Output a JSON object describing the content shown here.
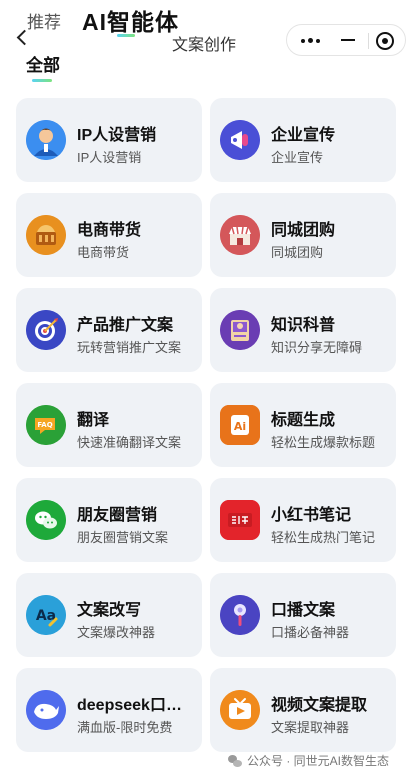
{
  "top_tabs": {
    "recommend": "推荐",
    "ai_agents": "AI智能体"
  },
  "nav": {
    "title": "文案创作"
  },
  "category": {
    "all": "全部"
  },
  "cards": [
    {
      "title": "IP人设营销",
      "sub": "IP人设营销",
      "icon": "avatar-person-icon",
      "color": "#2f7de1"
    },
    {
      "title": "企业宣传",
      "sub": "企业宣传",
      "icon": "megaphone-icon",
      "color": "#4b4fd8"
    },
    {
      "title": "电商带货",
      "sub": "电商带货",
      "icon": "shop-basket-icon",
      "color": "#e58a1f"
    },
    {
      "title": "同城团购",
      "sub": "同城团购",
      "icon": "storefront-icon",
      "color": "#d35a5a"
    },
    {
      "title": "产品推广文案",
      "sub": "玩转营销推广文案",
      "icon": "target-icon",
      "color": "#3b4bc8"
    },
    {
      "title": "知识科普",
      "sub": "知识分享无障碍",
      "icon": "book-icon",
      "color": "#6a3fb5"
    },
    {
      "title": "翻译",
      "sub": "快速准确翻译文案",
      "icon": "faq-icon",
      "color": "#2ea33a"
    },
    {
      "title": "标题生成",
      "sub": "轻松生成爆款标题",
      "icon": "ai-badge-icon",
      "color": "#e8731a"
    },
    {
      "title": "朋友圈营销",
      "sub": "朋友圈营销文案",
      "icon": "wechat-icon",
      "color": "#1faa3a"
    },
    {
      "title": "小红书笔记",
      "sub": "轻松生成热门笔记",
      "icon": "xiaohongshu-icon",
      "color": "#e3242b"
    },
    {
      "title": "文案改写",
      "sub": "文案爆改神器",
      "icon": "text-aa-icon",
      "color": "#2a9fd8"
    },
    {
      "title": "口播文案",
      "sub": "口播必备神器",
      "icon": "microphone-icon",
      "color": "#4a44c2"
    },
    {
      "title": "deepseek口播文案",
      "sub": "满血版-限时免费",
      "icon": "whale-icon",
      "color": "#4f6bed"
    },
    {
      "title": "视频文案提取",
      "sub": "文案提取神器",
      "icon": "tv-play-icon",
      "color": "#f08a1c"
    }
  ],
  "watermark": {
    "text": "公众号 · 同世元AI数智生态"
  }
}
